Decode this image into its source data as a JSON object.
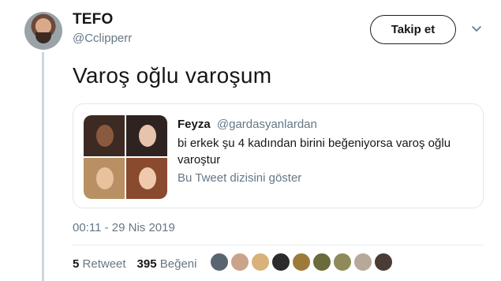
{
  "author": {
    "name": "TEFO",
    "handle": "@Cclipperr"
  },
  "follow_button": "Takip et",
  "tweet_text": "Varoş oğlu varoşum",
  "quoted": {
    "name": "Feyza",
    "handle": "@gardasyanlardan",
    "text": "bi erkek şu 4 kadından birini beğeniyorsa varoş oğlu varoştur",
    "thread_link": "Bu Tweet dizisini göster"
  },
  "timestamp": "00:11 - 29 Nis 2019",
  "stats": {
    "retweet_count": "5",
    "retweet_label": "Retweet",
    "like_count": "395",
    "like_label": "Beğeni"
  },
  "liker_avatar_colors": [
    "#5a6470",
    "#c9a48b",
    "#d9b27a",
    "#2b2b2b",
    "#9c7a3a",
    "#6b6a3a",
    "#8f8a5a",
    "#b7a99a",
    "#4a3b35"
  ],
  "colors": {
    "text_primary": "#14171a",
    "text_secondary": "#657786",
    "border": "#e1e8ed"
  }
}
